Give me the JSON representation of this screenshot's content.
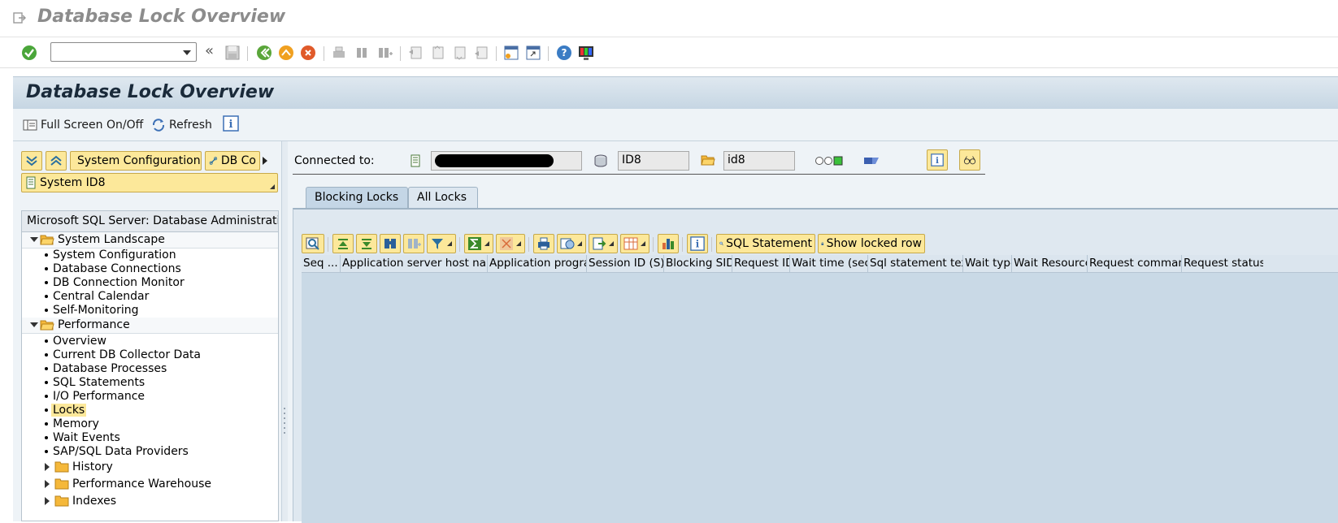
{
  "window": {
    "title": "Database Lock Overview"
  },
  "toolbar": {
    "command_value": ""
  },
  "header": {
    "title": "Database Lock Overview"
  },
  "app_toolbar": {
    "fullscreen_label": "Full Screen On/Off",
    "refresh_label": "Refresh"
  },
  "left_panel": {
    "buttons": {
      "system_config": "System Configuration",
      "db_co": "DB Co"
    },
    "system_field": "System ID8",
    "tree_header": "Microsoft SQL Server: Database Administration",
    "tree": {
      "system_landscape": "System Landscape",
      "landscape_items": [
        "System Configuration",
        "Database Connections",
        "DB Connection Monitor",
        "Central Calendar",
        "Self-Monitoring"
      ],
      "performance": "Performance",
      "performance_items": [
        "Overview",
        "Current DB Collector Data",
        "Database Processes",
        "SQL Statements",
        "I/O Performance",
        "Locks",
        "Memory",
        "Wait Events",
        "SAP/SQL Data Providers"
      ],
      "folders": [
        "History",
        "Performance Warehouse",
        "Indexes"
      ]
    }
  },
  "right_panel": {
    "connected_label": "Connected to:",
    "host_value": "",
    "system_id": "ID8",
    "db_name": "id8",
    "tabs": [
      "Blocking Locks",
      "All Locks"
    ],
    "grid_buttons": {
      "sql_statement": "SQL Statement",
      "show_locked_row": "Show locked row"
    },
    "columns": [
      "Seq ...",
      "Application server host name",
      "Application program",
      "Session ID (S)",
      "Blocking SID",
      "Request ID",
      "Wait time (sec)",
      "Sql statement text",
      "Wait type",
      "Wait Resource",
      "Request command",
      "Request status"
    ]
  },
  "colors": {
    "header_bg": "#c6d6e3",
    "button_yellow": "#fce89a",
    "grid_bg": "#c9d9e6"
  }
}
